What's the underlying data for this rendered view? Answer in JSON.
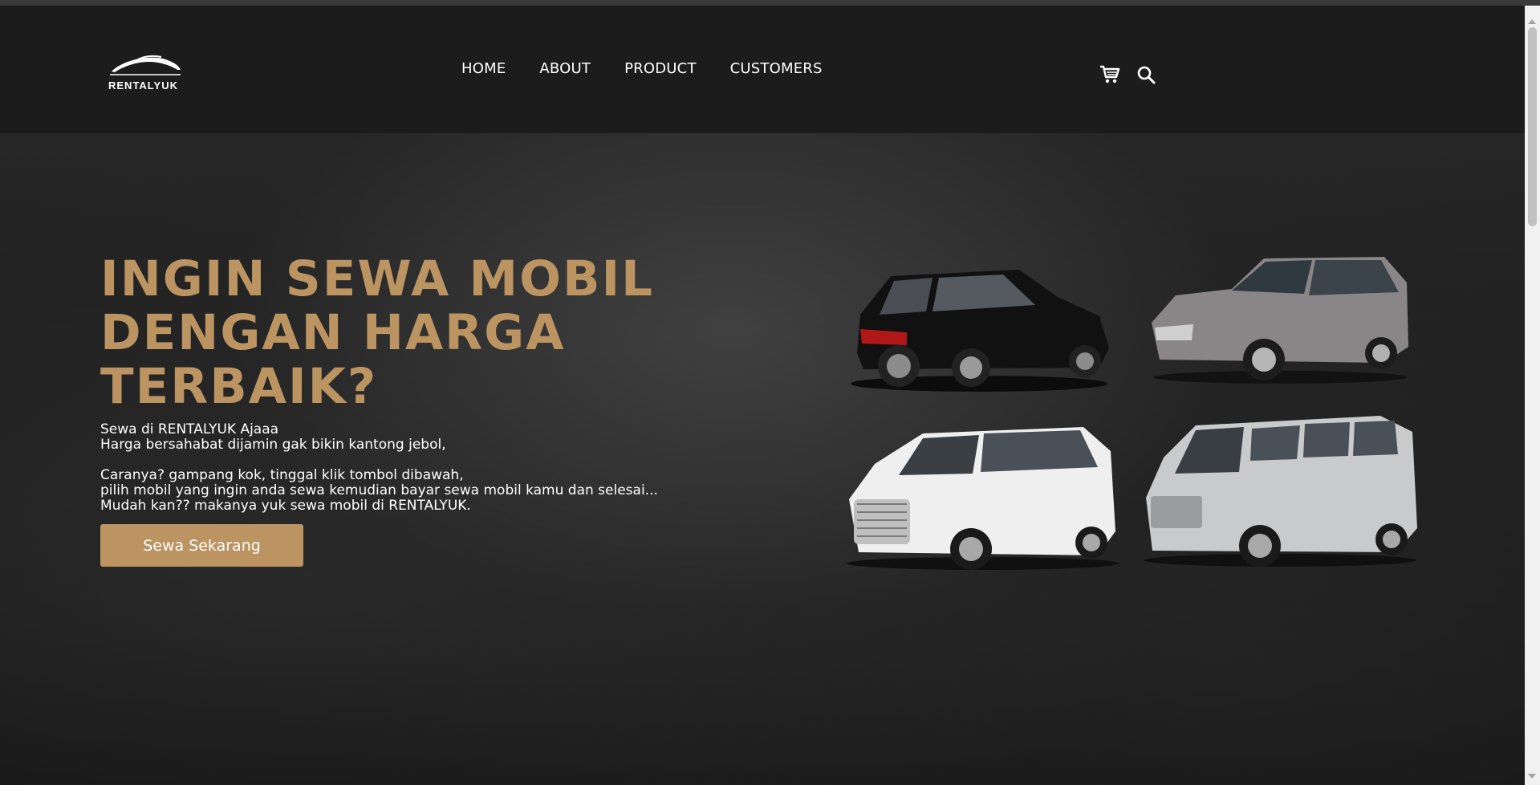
{
  "brand": {
    "logo_icon": "car-silhouette-logo",
    "name": "RENTALYUK"
  },
  "nav": {
    "items": [
      "HOME",
      "ABOUT",
      "PRODUCT",
      "CUSTOMERS"
    ],
    "icons": [
      "cart-icon",
      "search-icon"
    ]
  },
  "hero": {
    "title_lines": [
      "INGIN SEWA MOBIL",
      "DENGAN HARGA",
      "TERBAIK?"
    ],
    "text": {
      "line1": "Sewa di RENTALYUK Ajaaa",
      "line2": "Harga bersahabat dijamin gak bikin kantong jebol,",
      "line3": "Caranya? gampang kok, tinggal klik tombol dibawah,",
      "line4": "pilih mobil yang ingin anda sewa kemudian bayar sewa mobil kamu dan selesai...",
      "line5": "Mudah kan?? makanya yuk sewa mobil di RENTALYUK."
    },
    "cta_label": "Sewa Sekarang"
  },
  "cars": [
    "black-mpv-image",
    "grey-mpv-image",
    "white-luxury-van-image",
    "silver-minibus-image"
  ],
  "colors": {
    "accent": "#bb9462",
    "nav_background": "#1c1c1c",
    "hero_background": "#1e1e1e",
    "text": "#ffffff"
  }
}
